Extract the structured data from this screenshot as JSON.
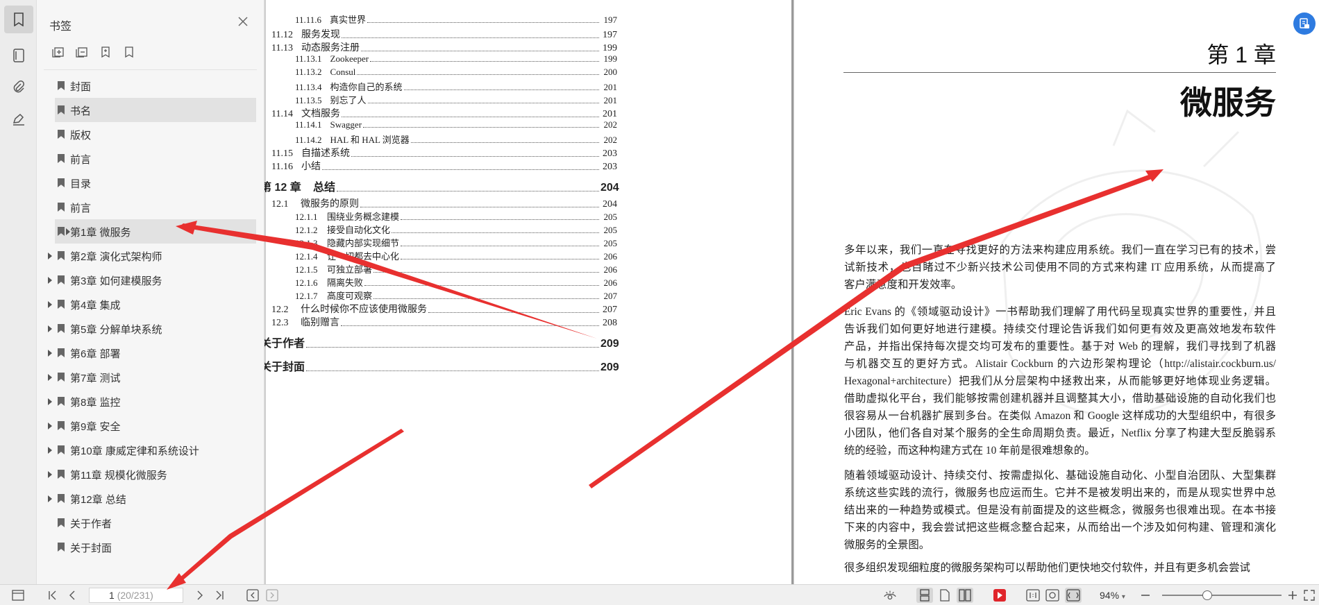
{
  "panel": {
    "title": "书签",
    "bookmarks": [
      {
        "label": "封面",
        "expandable": false
      },
      {
        "label": "书名",
        "expandable": false,
        "selected": true
      },
      {
        "label": "版权",
        "expandable": false
      },
      {
        "label": "前言",
        "expandable": false
      },
      {
        "label": "目录",
        "expandable": false
      },
      {
        "label": "前言",
        "expandable": false
      },
      {
        "label": "第1章 微服务",
        "expandable": true,
        "highlighted": true
      },
      {
        "label": "第2章 演化式架构师",
        "expandable": true
      },
      {
        "label": "第3章 如何建模服务",
        "expandable": true
      },
      {
        "label": "第4章 集成",
        "expandable": true
      },
      {
        "label": "第5章 分解单块系统",
        "expandable": true
      },
      {
        "label": "第6章 部署",
        "expandable": true
      },
      {
        "label": "第7章 测试",
        "expandable": true
      },
      {
        "label": "第8章 监控",
        "expandable": true
      },
      {
        "label": "第9章 安全",
        "expandable": true
      },
      {
        "label": "第10章 康威定律和系统设计",
        "expandable": true
      },
      {
        "label": "第11章 规模化微服务",
        "expandable": true
      },
      {
        "label": "第12章 总结",
        "expandable": true
      },
      {
        "label": "关于作者",
        "expandable": false
      },
      {
        "label": "关于封面",
        "expandable": false
      }
    ]
  },
  "toc": {
    "entries": [
      {
        "num": "11.11.6",
        "text": "真实世界",
        "page": "197",
        "level": 3
      },
      {
        "num": "11.12",
        "text": "服务发现",
        "page": "197",
        "level": 2
      },
      {
        "num": "11.13",
        "text": "动态服务注册",
        "page": "199",
        "level": 2
      },
      {
        "num": "11.13.1",
        "text": "Zookeeper",
        "page": "199",
        "level": 3
      },
      {
        "num": "11.13.2",
        "text": "Consul",
        "page": "200",
        "level": 3
      },
      {
        "num": "11.13.4",
        "text": "构造你自己的系统",
        "page": "201",
        "level": 3
      },
      {
        "num": "11.13.5",
        "text": "别忘了人",
        "page": "201",
        "level": 3
      },
      {
        "num": "11.14",
        "text": "文档服务",
        "page": "201",
        "level": 2
      },
      {
        "num": "11.14.1",
        "text": "Swagger",
        "page": "202",
        "level": 3
      },
      {
        "num": "11.14.2",
        "text": "HAL 和 HAL 浏览器",
        "page": "202",
        "level": 3
      },
      {
        "num": "11.15",
        "text": "自描述系统",
        "page": "203",
        "level": 2
      },
      {
        "num": "11.16",
        "text": "小结",
        "page": "203",
        "level": 2
      },
      {
        "num": "第 12 章",
        "text": "总结",
        "page": "204",
        "level": 1
      },
      {
        "num": "12.1",
        "text": "微服务的原则",
        "page": "204",
        "level": 2
      },
      {
        "num": "12.1.1",
        "text": "围绕业务概念建模",
        "page": "205",
        "level": 3
      },
      {
        "num": "12.1.2",
        "text": "接受自动化文化",
        "page": "205",
        "level": 3
      },
      {
        "num": "12.1.3",
        "text": "隐藏内部实现细节",
        "page": "205",
        "level": 3
      },
      {
        "num": "12.1.4",
        "text": "让一切都去中心化",
        "page": "206",
        "level": 3
      },
      {
        "num": "12.1.5",
        "text": "可独立部署",
        "page": "206",
        "level": 3
      },
      {
        "num": "12.1.6",
        "text": "隔离失败",
        "page": "206",
        "level": 3
      },
      {
        "num": "12.1.7",
        "text": "高度可观察",
        "page": "207",
        "level": 3
      },
      {
        "num": "12.2",
        "text": "什么时候你不应该使用微服务",
        "page": "207",
        "level": 2
      },
      {
        "num": "12.3",
        "text": "临别赠言",
        "page": "208",
        "level": 2
      },
      {
        "num": "",
        "text": "关于作者",
        "page": "209",
        "level": 0
      },
      {
        "num": "",
        "text": "关于封面",
        "page": "209",
        "level": 0
      }
    ]
  },
  "chapter": {
    "number": "第 1 章",
    "title": "微服务",
    "paragraphs": [
      [
        "多年以来，我们一直在寻找更好的方法来构建应用系统。我们一直在学习已有的技术，尝",
        "试新技术，也目睹过不少新兴技术公司使用不同的方式来构建 IT 应用系统，从而提高了",
        "客户满意度和开发效率。"
      ],
      [
        "Eric Evans 的《领域驱动设计》一书帮助我们理解了用代码呈现真实世界的重要性，并且",
        "告诉我们如何更好地进行建模。持续交付理论告诉我们如何更有效及更高效地发布软件",
        "产品，并指出保持每次提交均可发布的重要性。基于对 Web 的理解，我们寻找到了机器",
        "与机器交互的更好方式。Alistair Cockburn 的六边形架构理论（http://alistair.cockburn.us/",
        "Hexagonal+architecture）把我们从分层架构中拯救出来，从而能够更好地体现业务逻辑。",
        "借助虚拟化平台，我们能够按需创建机器并且调整其大小，借助基础设施的自动化我们也",
        "很容易从一台机器扩展到多台。在类似 Amazon 和 Google 这样成功的大型组织中，有很多",
        "小团队，他们各自对某个服务的全生命周期负责。最近，Netflix 分享了构建大型反脆弱系",
        "统的经验，而这种构建方式在 10 年前是很难想象的。"
      ],
      [
        "随着领域驱动设计、持续交付、按需虚拟化、基础设施自动化、小型自治团队、大型集群",
        "系统这些实践的流行，微服务也应运而生。它并不是被发明出来的，而是从现实世界中总",
        "结出来的一种趋势或模式。但是没有前面提及的这些概念，微服务也很难出现。在本书接",
        "下来的内容中，我会尝试把这些概念整合起来，从而给出一个涉及如何构建、管理和演化",
        "微服务的全景图。"
      ],
      [
        "很多组织发现细粒度的微服务架构可以帮助他们更快地交付软件，并且有更多机会尝试"
      ]
    ]
  },
  "statusbar": {
    "current_page": "1",
    "page_total": "(20/231)",
    "zoom": "94%",
    "zoom_fraction": 0.38
  },
  "colors": {
    "accent": "#2e7be0",
    "arrow": "#e8302f",
    "play": "#e0252b"
  }
}
